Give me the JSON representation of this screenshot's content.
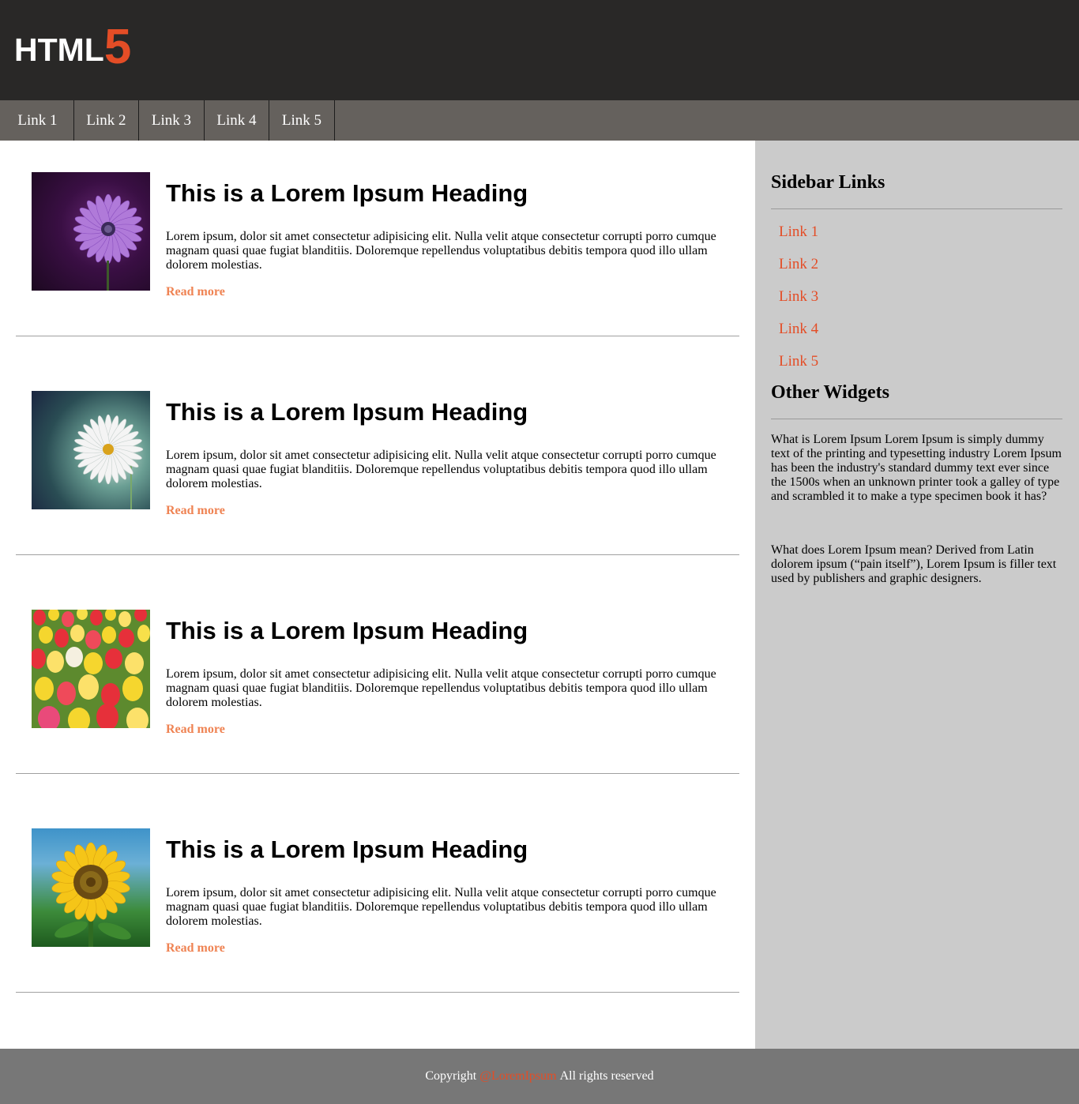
{
  "header": {
    "logo_text": "HTML",
    "logo_number": "5"
  },
  "nav": {
    "links": [
      "Link 1",
      "Link 2",
      "Link 3",
      "Link 4",
      "Link 5"
    ]
  },
  "articles": [
    {
      "title": "This is a Lorem Ipsum Heading",
      "body": "Lorem ipsum, dolor sit amet consectetur adipisicing elit. Nulla velit atque consectetur corrupti porro cumque magnam quasi quae fugiat blanditiis. Doloremque repellendus voluptatibus debitis tempora quod illo ullam dolorem molestias.",
      "link": "Read more",
      "image": "purple-flower-image"
    },
    {
      "title": "This is a Lorem Ipsum Heading",
      "body": "Lorem ipsum, dolor sit amet consectetur adipisicing elit. Nulla velit atque consectetur corrupti porro cumque magnam quasi quae fugiat blanditiis. Doloremque repellendus voluptatibus debitis tempora quod illo ullam dolorem molestias.",
      "link": "Read more",
      "image": "daisy-image"
    },
    {
      "title": "This is a Lorem Ipsum Heading",
      "body": "Lorem ipsum, dolor sit amet consectetur adipisicing elit. Nulla velit atque consectetur corrupti porro cumque magnam quasi quae fugiat blanditiis. Doloremque repellendus voluptatibus debitis tempora quod illo ullam dolorem molestias.",
      "link": "Read more",
      "image": "tulips-image"
    },
    {
      "title": "This is a Lorem Ipsum Heading",
      "body": "Lorem ipsum, dolor sit amet consectetur adipisicing elit. Nulla velit atque consectetur corrupti porro cumque magnam quasi quae fugiat blanditiis. Doloremque repellendus voluptatibus debitis tempora quod illo ullam dolorem molestias.",
      "link": "Read more",
      "image": "sunflower-image"
    }
  ],
  "sidebar": {
    "links_title": "Sidebar Links",
    "links": [
      "Link 1",
      "Link 2",
      "Link 3",
      "Link 4",
      "Link 5"
    ],
    "widgets_title": "Other Widgets",
    "para1": "What is Lorem Ipsum Lorem Ipsum is simply dummy text of the printing and typesetting industry Lorem Ipsum has been the industry's standard dummy text ever since the 1500s when an unknown printer took a galley of type and scrambled it to make a type specimen book it has?",
    "para2": "What does Lorem Ipsum mean? Derived from Latin dolorem ipsum (“pain itself”), Lorem Ipsum is filler text used by publishers and graphic designers."
  },
  "footer": {
    "prefix": "Copyright",
    "brand": "@LoremIpsum",
    "suffix": "All rights reserved"
  },
  "colors": {
    "header_bg": "#292827",
    "nav_bg": "#65615d",
    "accent": "#e44d26",
    "read_more": "#ef8353",
    "sidebar_bg": "#cbcbcb",
    "footer_bg": "#777777"
  }
}
